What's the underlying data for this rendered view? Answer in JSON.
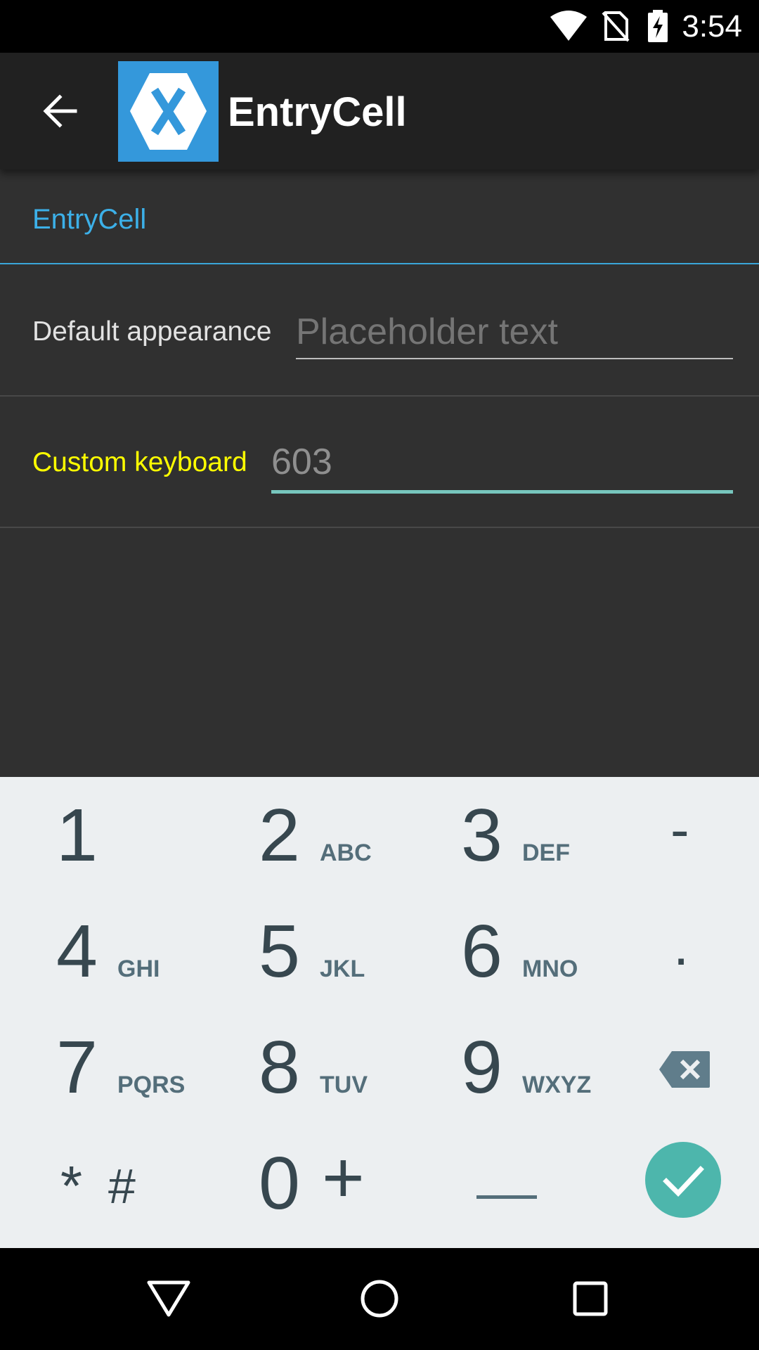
{
  "status_bar": {
    "time": "3:54",
    "icons": [
      "wifi-icon",
      "no-sim-icon",
      "battery-charging-icon"
    ]
  },
  "toolbar": {
    "back_icon": "arrow-back-icon",
    "logo_icon": "xamarin-logo-icon",
    "title": "EntryCell"
  },
  "table": {
    "section_header": "EntryCell",
    "rows": [
      {
        "label": "Default appearance",
        "placeholder": "Placeholder text",
        "value": ""
      },
      {
        "label": "Custom keyboard",
        "placeholder": "",
        "value": "603"
      }
    ]
  },
  "keyboard": {
    "keys": [
      {
        "digit": "1",
        "letters": ""
      },
      {
        "digit": "2",
        "letters": "ABC"
      },
      {
        "digit": "3",
        "letters": "DEF"
      },
      {
        "digit": "-",
        "letters": ""
      },
      {
        "digit": "4",
        "letters": "GHI"
      },
      {
        "digit": "5",
        "letters": "JKL"
      },
      {
        "digit": "6",
        "letters": "MNO"
      },
      {
        "digit": ".",
        "letters": ""
      },
      {
        "digit": "7",
        "letters": "PQRS"
      },
      {
        "digit": "8",
        "letters": "TUV"
      },
      {
        "digit": "9",
        "letters": "WXYZ"
      },
      {
        "digit": "*",
        "letters": "#"
      },
      {
        "digit": "0",
        "letters": "+"
      }
    ],
    "icons": [
      "backspace-icon",
      "space-icon",
      "done-check-icon"
    ]
  },
  "nav_bar": {
    "icons": [
      "back-triangle-icon",
      "home-circle-icon",
      "recents-square-icon"
    ]
  },
  "colors": {
    "accent_blue": "#3cb0e8",
    "label_highlight": "#ffff00",
    "input_underline_active": "#77c6bd",
    "done_button": "#4db6ac",
    "logo_blue": "#3498db"
  }
}
